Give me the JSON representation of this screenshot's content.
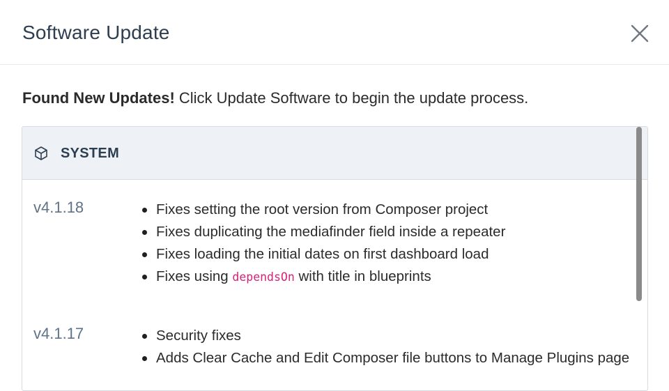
{
  "dialog": {
    "title": "Software Update",
    "close_icon": "close-icon"
  },
  "intro": {
    "bold": "Found New Updates!",
    "text": " Click Update Software to begin the update process."
  },
  "section": {
    "icon": "box-icon",
    "label": "SYSTEM"
  },
  "updates": [
    {
      "version": "v4.1.18",
      "changes": [
        {
          "text": "Fixes setting the root version from Composer project"
        },
        {
          "text": "Fixes duplicating the mediafinder field inside a repeater"
        },
        {
          "text": "Fixes loading the initial dates on first dashboard load"
        },
        {
          "prefix": "Fixes using ",
          "code": "dependsOn",
          "suffix": " with title in blueprints"
        }
      ]
    },
    {
      "version": "v4.1.17",
      "changes": [
        {
          "text": "Security fixes"
        },
        {
          "text": "Adds Clear Cache and Edit Composer file buttons to Manage Plugins page"
        }
      ]
    }
  ],
  "colors": {
    "title": "#2d3e50",
    "version": "#5f7288",
    "code": "#d3237a",
    "panel_header_bg": "#eef2f7"
  }
}
